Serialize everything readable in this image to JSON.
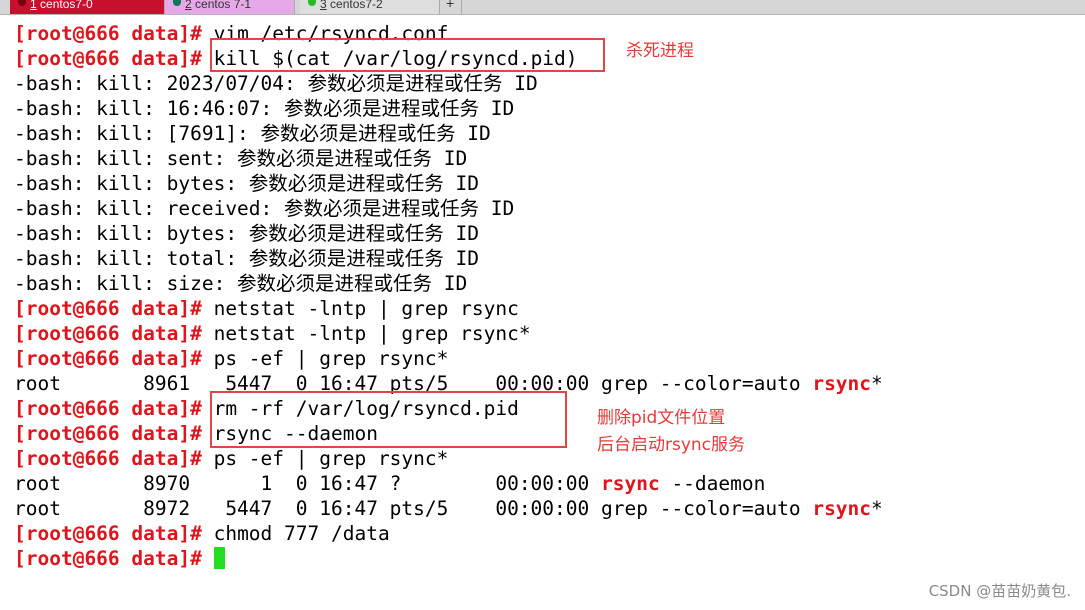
{
  "tabs": [
    {
      "num": "1",
      "label": " centos7-0",
      "dot_color": "#7a0010",
      "bg": "#c8102e"
    },
    {
      "num": "2",
      "label": " centos 7-1",
      "dot_color": "#0a7a5a",
      "bg": "#e6a8e6"
    },
    {
      "num": "3",
      "label": " centos7-2",
      "dot_color": "#20c020",
      "bg": "#dedede"
    }
  ],
  "add_tab": "+",
  "terminal": {
    "prompt": "[root@666 data]#",
    "lines": [
      {
        "prompt": "[root@666 data]#",
        "text": " vim /etc/rsyncd.conf"
      },
      {
        "prompt": "[root@666 data]#",
        "text": " kill $(cat /var/log/rsyncd.pid)"
      },
      {
        "text": "-bash: kill: 2023/07/04: 参数必须是进程或任务 ID"
      },
      {
        "text": "-bash: kill: 16:46:07: 参数必须是进程或任务 ID"
      },
      {
        "text": "-bash: kill: [7691]: 参数必须是进程或任务 ID"
      },
      {
        "text": "-bash: kill: sent: 参数必须是进程或任务 ID"
      },
      {
        "text": "-bash: kill: bytes: 参数必须是进程或任务 ID"
      },
      {
        "text": "-bash: kill: received: 参数必须是进程或任务 ID"
      },
      {
        "text": "-bash: kill: bytes: 参数必须是进程或任务 ID"
      },
      {
        "text": "-bash: kill: total: 参数必须是进程或任务 ID"
      },
      {
        "text": "-bash: kill: size: 参数必须是进程或任务 ID"
      },
      {
        "prompt": "[root@666 data]#",
        "text": " netstat -lntp | grep rsync"
      },
      {
        "prompt": "[root@666 data]#",
        "text": " netstat -lntp | grep rsync*"
      },
      {
        "prompt": "[root@666 data]#",
        "text": " ps -ef | grep rsync*"
      },
      {
        "text": "root       8961   5447  0 16:47 pts/5    00:00:00 grep --color=auto ",
        "hl": "rsync",
        "after": "*"
      },
      {
        "prompt": "[root@666 data]#",
        "text": " rm -rf /var/log/rsyncd.pid"
      },
      {
        "prompt": "[root@666 data]#",
        "text": " rsync --daemon"
      },
      {
        "prompt": "[root@666 data]#",
        "text": " ps -ef | grep rsync*"
      },
      {
        "text": "root       8970      1  0 16:47 ?        00:00:00 ",
        "hl": "rsync",
        "after": " --daemon"
      },
      {
        "text": "root       8972   5447  0 16:47 pts/5    00:00:00 grep --color=auto ",
        "hl": "rsync",
        "after": "*"
      },
      {
        "prompt": "[root@666 data]#",
        "text": " chmod 777 /data"
      },
      {
        "prompt": "[root@666 data]#",
        "text": " ",
        "cursor": true
      }
    ]
  },
  "annotations": {
    "note1": "杀死进程",
    "note2": "删除pid文件位置",
    "note3": "后台启动rsync服务"
  },
  "colors": {
    "prompt": "#e0141c",
    "annotation": "#e63a3a",
    "cursor": "#22dd22"
  },
  "watermark": "CSDN @苗苗奶黄包."
}
